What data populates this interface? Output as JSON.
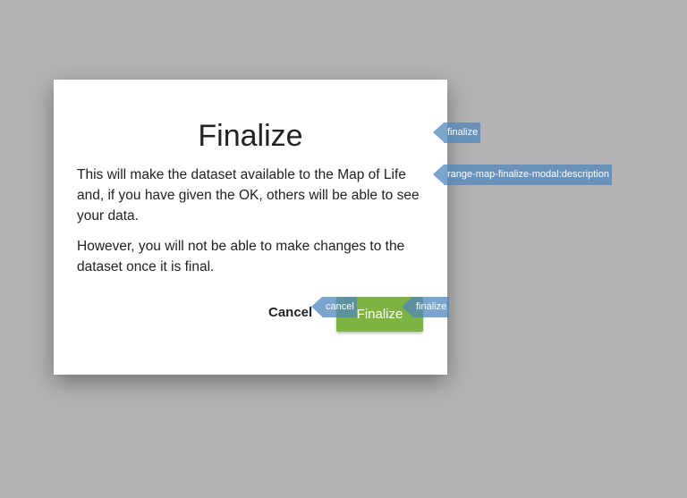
{
  "modal": {
    "title": "Finalize",
    "paragraphs": [
      "This will make the dataset available to the Map of Life and, if you have given the OK, others will be able to see your data.",
      "However, you will not be able to make changes to the dataset once it is final."
    ],
    "cancel_label": "Cancel",
    "finalize_label": "Finalize"
  },
  "tags": {
    "title": "finalize",
    "description": "range-map-finalize-modal:description",
    "cancel": "cancel",
    "finalize": "finalize"
  },
  "colors": {
    "primary": "#7cb342",
    "tag": "#5087be"
  }
}
